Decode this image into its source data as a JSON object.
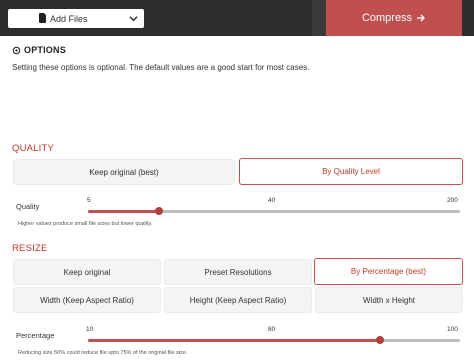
{
  "topbar": {
    "add_files_label": "Add Files",
    "compress_label": "Compress",
    "accent": "#c0504d"
  },
  "options": {
    "title": "OPTIONS",
    "description": "Setting these options is optional. The default values are a good start for most cases."
  },
  "quality": {
    "title": "QUALITY",
    "modes": [
      "Keep original (best)",
      "By Quality Level"
    ],
    "selected_mode": "By Quality Level",
    "slider": {
      "label": "Quality",
      "ticks": [
        "5",
        "40",
        "200"
      ],
      "value": 20,
      "hint": "Higher values produce small file sizes but lower quality."
    }
  },
  "resize": {
    "title": "RESIZE",
    "modes": [
      "Keep original",
      "Preset Resolutions",
      "By Percentage (best)",
      "Width (Keep Aspect Ratio)",
      "Height (Keep Aspect Ratio)",
      "Width x Height"
    ],
    "selected_mode": "By Percentage (best)",
    "slider": {
      "label": "Percentage",
      "ticks": [
        "10",
        "80",
        "100"
      ],
      "value": 75,
      "hint": "Reducing size 50% could reduce file upto 75% of the original file size."
    }
  },
  "icons": {
    "add_files": "file-icon",
    "dropdown": "chevron-down-icon",
    "compress": "arrow-right-icon",
    "options": "gear-icon"
  }
}
